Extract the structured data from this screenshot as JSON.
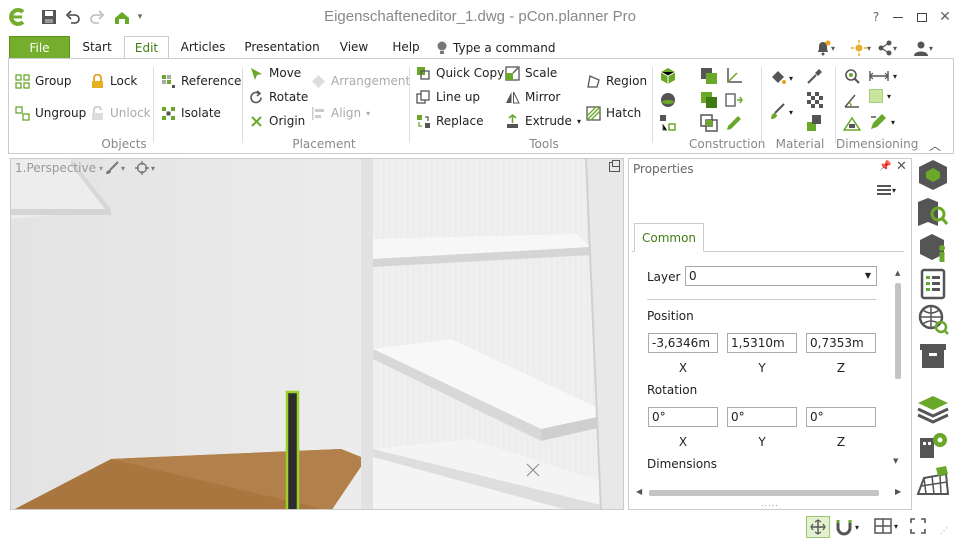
{
  "window": {
    "title": "Eigenschafteneditor_1.dwg - pCon.planner Pro",
    "help": "?"
  },
  "tabs": [
    {
      "label": "File"
    },
    {
      "label": "Start"
    },
    {
      "label": "Edit"
    },
    {
      "label": "Articles"
    },
    {
      "label": "Presentation"
    },
    {
      "label": "View"
    },
    {
      "label": "Help"
    }
  ],
  "command_search": {
    "placeholder": "Type a command"
  },
  "ribbon": {
    "objects": {
      "label": "Objects",
      "group": "Group",
      "ungroup": "Ungroup",
      "lock": "Lock",
      "unlock": "Unlock",
      "reference": "Reference",
      "isolate": "Isolate"
    },
    "placement": {
      "label": "Placement",
      "move": "Move",
      "rotate": "Rotate",
      "origin": "Origin",
      "arrangement": "Arrangement",
      "align": "Align"
    },
    "tools": {
      "label": "Tools",
      "quick_copy": "Quick Copy",
      "line_up": "Line up",
      "replace": "Replace",
      "scale": "Scale",
      "mirror": "Mirror",
      "extrude": "Extrude",
      "region": "Region",
      "hatch": "Hatch"
    },
    "construction": {
      "label": "Construction"
    },
    "material": {
      "label": "Material"
    },
    "dimensioning": {
      "label": "Dimensioning"
    }
  },
  "viewport": {
    "label": "1.Perspective"
  },
  "properties": {
    "title": "Properties",
    "tab": "Common",
    "layer_label": "Layer",
    "layer_value": "0",
    "position_label": "Position",
    "position": {
      "x": "-3,6346m",
      "y": "1,5310m",
      "z": "0,7353m"
    },
    "rotation_label": "Rotation",
    "rotation": {
      "x": "0°",
      "y": "0°",
      "z": "0°"
    },
    "axis": {
      "x": "X",
      "y": "Y",
      "z": "Z"
    },
    "dimensions_label": "Dimensions"
  },
  "colors": {
    "accent": "#75ad2c",
    "ribbon_active_text": "#3f7d14",
    "icon_green": "#6aa829"
  }
}
